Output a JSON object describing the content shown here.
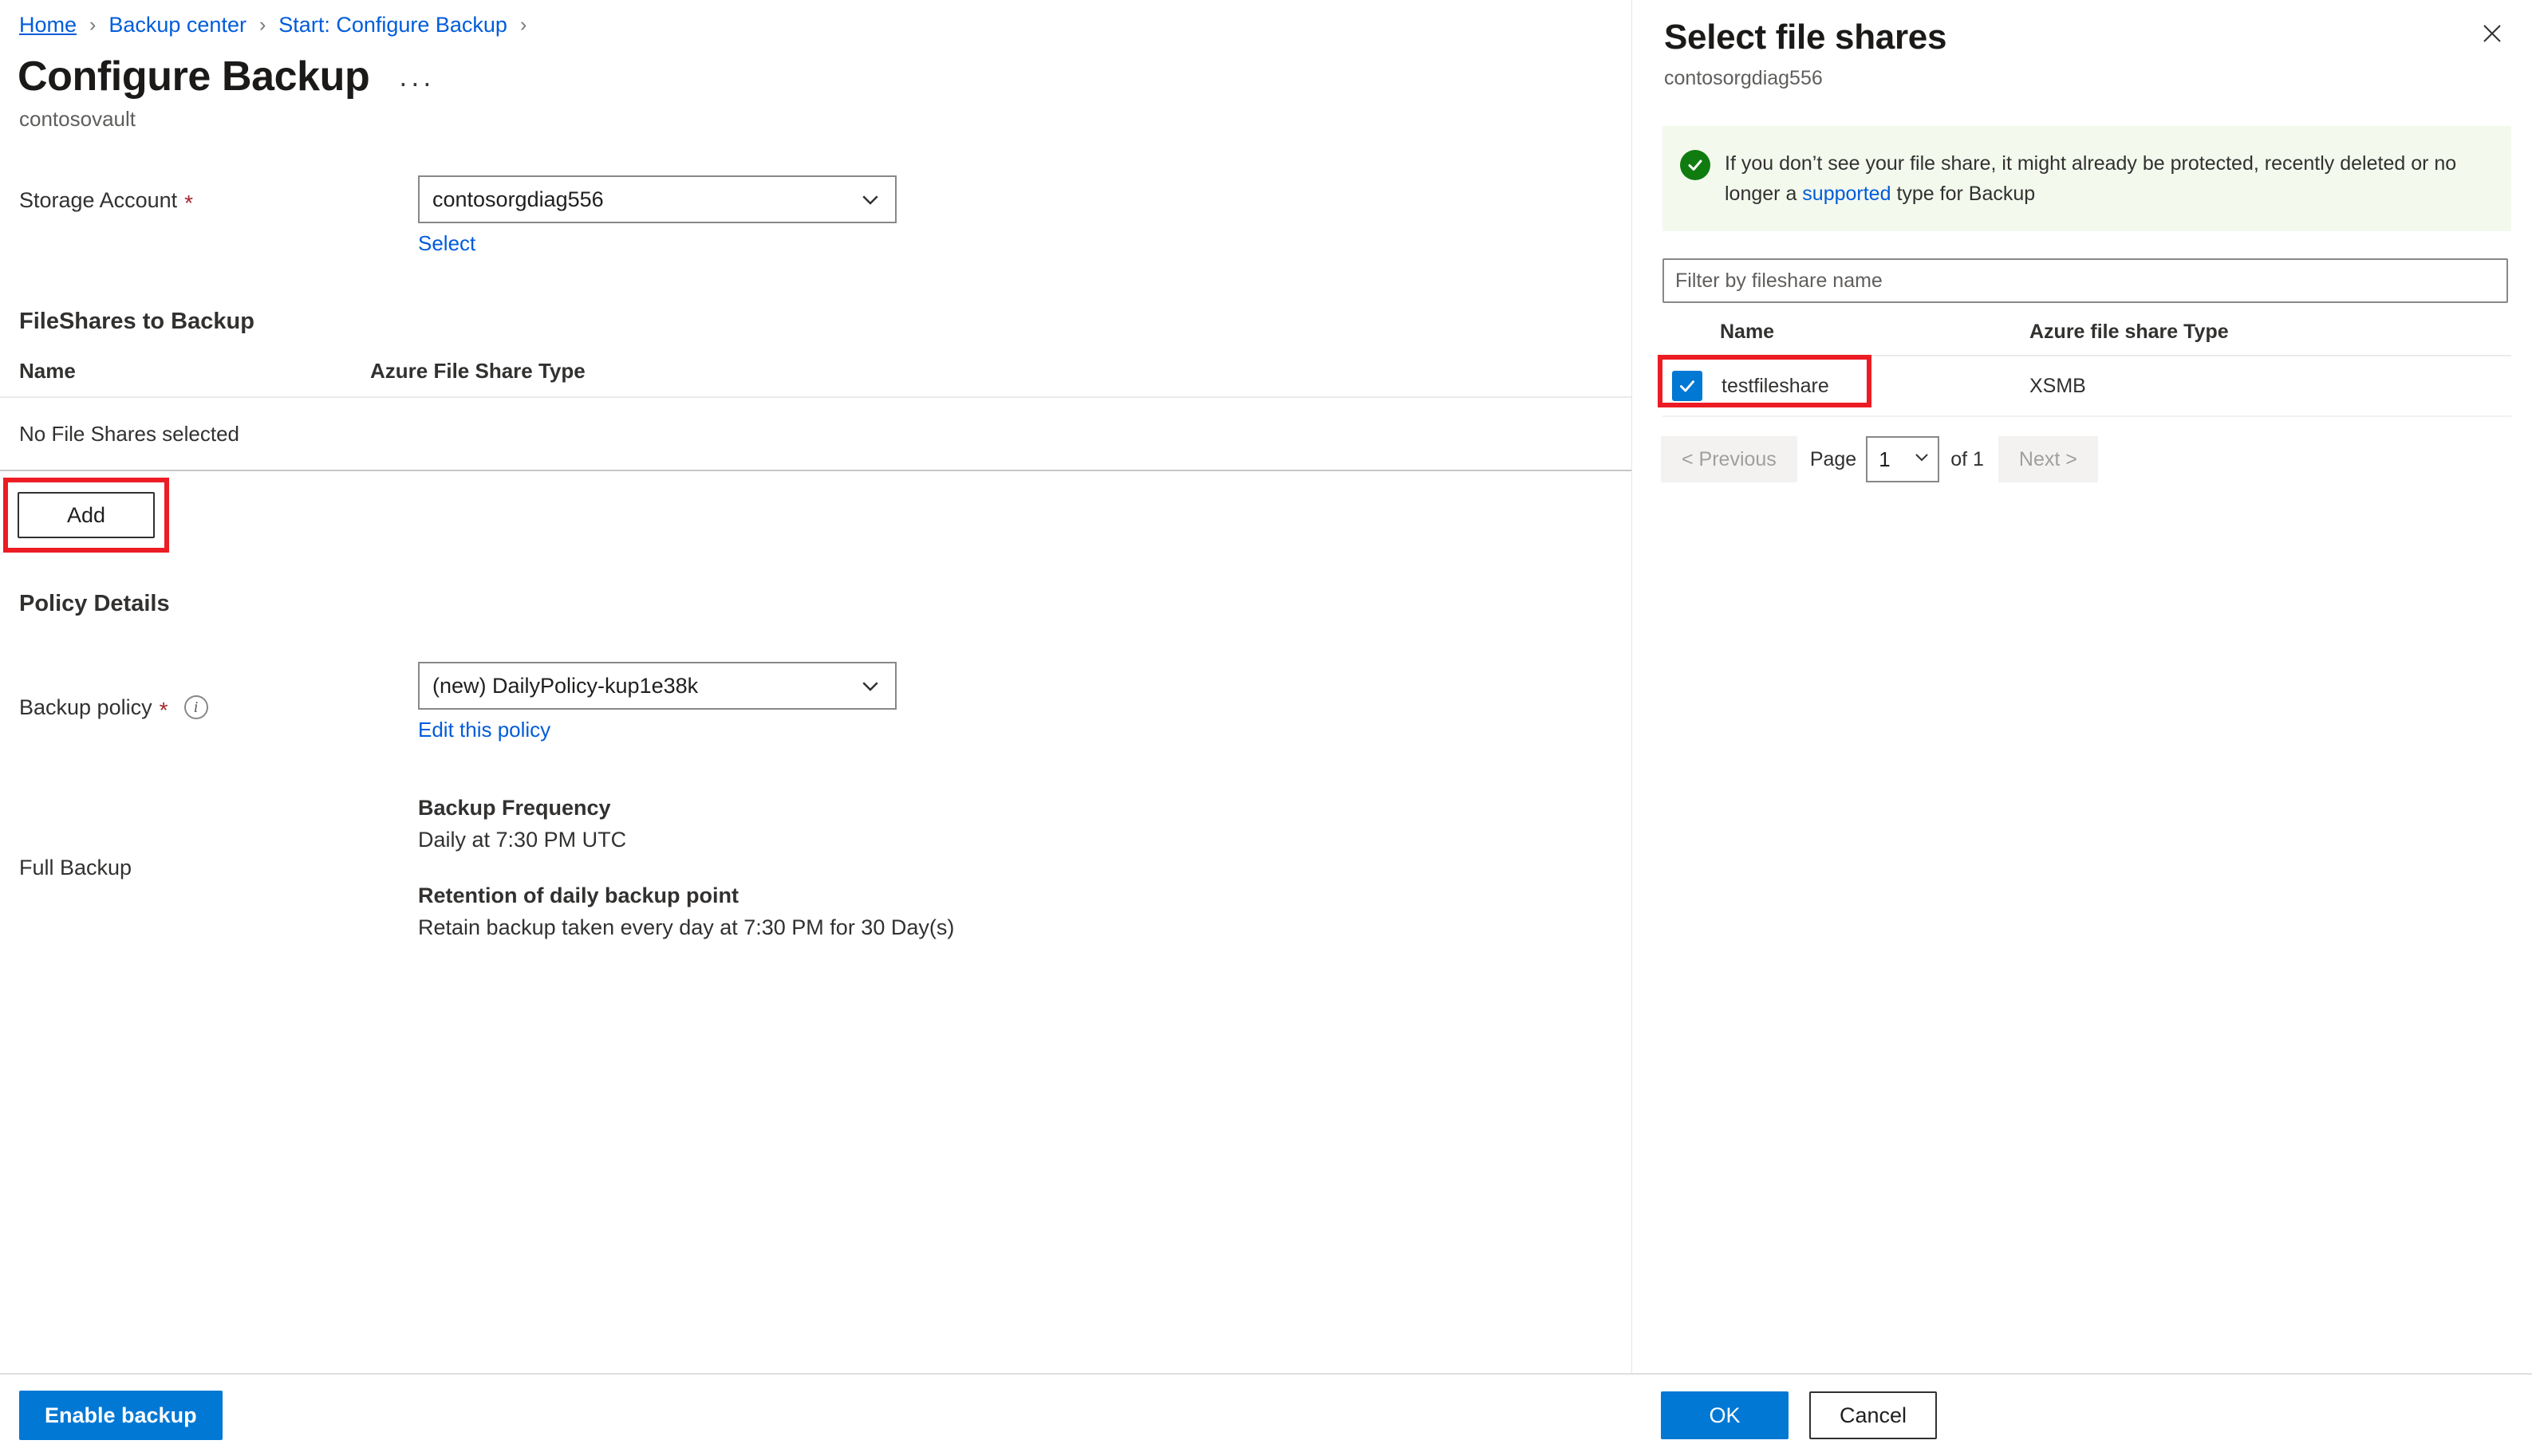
{
  "breadcrumb": {
    "items": [
      {
        "label": "Home",
        "type": "link-underlined"
      },
      {
        "label": "Backup center",
        "type": "link"
      },
      {
        "label": "Start: Configure Backup",
        "type": "link"
      }
    ],
    "separator": "›"
  },
  "header": {
    "title": "Configure Backup",
    "subtitle": "contosovault",
    "more_actions": "···"
  },
  "form": {
    "storage_account": {
      "label": "Storage Account",
      "required_marker": "*",
      "value": "contosorgdiag556",
      "select_link": "Select",
      "chevron_icon": "chevron-down-icon"
    }
  },
  "fileshares_section": {
    "heading": "FileShares to Backup",
    "columns": [
      "Name",
      "Azure File Share Type"
    ],
    "rows": [
      {
        "name": "No File Shares selected",
        "type": ""
      }
    ],
    "add_button": "Add"
  },
  "policy_section": {
    "heading": "Policy Details",
    "backup_policy": {
      "label": "Backup policy",
      "required_marker": "*",
      "info_icon": "info-icon",
      "value": "(new) DailyPolicy-kup1e38k",
      "edit_link": "Edit this policy"
    },
    "full_backup": {
      "label": "Full Backup",
      "frequency_heading": "Backup Frequency",
      "frequency_value": "Daily at 7:30 PM UTC",
      "retention_heading": "Retention of daily backup point",
      "retention_value": "Retain backup taken every day at 7:30 PM for 30 Day(s)"
    }
  },
  "left_footer": {
    "enable_backup": "Enable backup"
  },
  "panel": {
    "title": "Select file shares",
    "subtitle": "contosorgdiag556",
    "close_icon": "close-icon",
    "banner": {
      "icon": "success-check-circle-icon",
      "text_before": "If you don’t see your file share, it might already be protected, recently deleted or no longer a ",
      "link": "supported",
      "text_after": " type for Backup"
    },
    "filter": {
      "placeholder": "Filter by fileshare name",
      "value": ""
    },
    "table": {
      "columns": [
        "Name",
        "Azure file share Type"
      ],
      "rows": [
        {
          "name": "testfileshare",
          "type": "XSMB",
          "checked": true
        }
      ]
    },
    "pagination": {
      "previous": "< Previous",
      "page_label": "Page",
      "current_page": "1",
      "of_label": "of 1",
      "next": "Next >",
      "chevron_icon": "chevron-down-icon"
    },
    "footer": {
      "ok": "OK",
      "cancel": "Cancel"
    }
  },
  "colors": {
    "accent": "#0078d4",
    "link": "#015cda",
    "annotation": "#ec1c24",
    "success": "#107c10",
    "required": "#a4262c",
    "banner_bg": "#f4f9ee"
  }
}
